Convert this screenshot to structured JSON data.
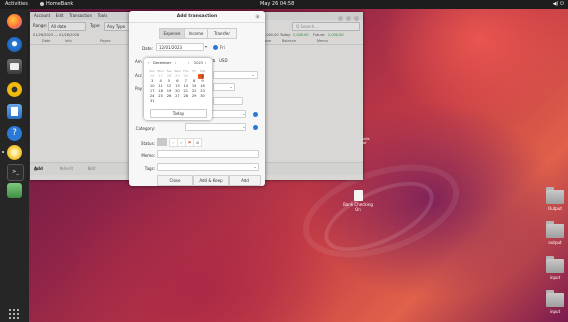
{
  "topbar": {
    "activities": "Activities",
    "app_name": "HomeBank",
    "clock": "May 26 04:58",
    "tray": "◀) ⏻"
  },
  "main_window": {
    "menu": [
      "Account",
      "Edit",
      "Transaction",
      "Tools"
    ],
    "range_label": "Range:",
    "range_value": "All date",
    "type_label": "Type:",
    "type_value": "Any Type",
    "status_label": "Stat",
    "search_placeholder": "Q Search...",
    "date_range": "01/26/2023 — 01/26/2026",
    "totals_left": "2,000.00",
    "today_label": "Today:",
    "today_value": "2,000.00",
    "future_label": "Future:",
    "future_value": "2,000.00",
    "columns": [
      "Date",
      "Info",
      "Payee",
      "Done",
      "Balance",
      "Memo"
    ],
    "toolbar": {
      "add": "Add",
      "inherit": "Inherit",
      "edit": "Edit"
    },
    "side_fragment": "uifa\nof"
  },
  "dialog": {
    "title": "Add transaction",
    "types": [
      "Expense",
      "Income",
      "Transfer"
    ],
    "date_label": "Date:",
    "date_value": "12/01/2023",
    "weekday": "Fri",
    "currency": "USD",
    "category_label": "Category:",
    "status_label": "Status:",
    "memo_label": "Memo:",
    "tags_label": "Tags:",
    "buttons": {
      "close": "Close",
      "add_keep": "Add & Keep",
      "add": "Add"
    },
    "partial_labels": [
      "Am",
      "Acc",
      "Pay"
    ]
  },
  "calendar": {
    "month": "December",
    "year": "2023",
    "weekdays": [
      "Sun",
      "Mon",
      "Tue",
      "Wed",
      "Thu",
      "Fri",
      "Sat"
    ],
    "weeks": [
      [
        "26",
        "27",
        "28",
        "29",
        "30",
        "1",
        "2"
      ],
      [
        "3",
        "4",
        "5",
        "6",
        "7",
        "8",
        "9"
      ],
      [
        "10",
        "11",
        "12",
        "13",
        "14",
        "15",
        "16"
      ],
      [
        "17",
        "18",
        "19",
        "20",
        "21",
        "22",
        "23"
      ],
      [
        "24",
        "25",
        "26",
        "27",
        "28",
        "29",
        "30"
      ],
      [
        "31",
        "",
        "",
        "",
        "",
        "",
        ""
      ]
    ],
    "selected_day": "1",
    "today_button": "Today"
  },
  "desktop": {
    "account_label": "Bank Checking\nOn",
    "icons": [
      "Output",
      "output",
      "input",
      "input"
    ]
  },
  "colors": {
    "accent": "#e95420",
    "info": "#2b79d7",
    "topbar": "#1d1d1d",
    "dock": "#262626"
  }
}
